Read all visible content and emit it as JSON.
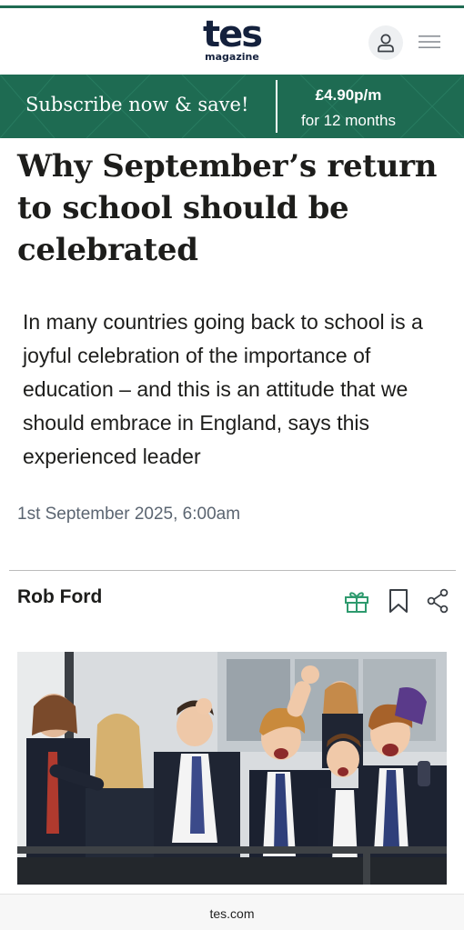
{
  "masthead": {
    "logo_word": "tes",
    "logo_sub": "magazine",
    "account_icon": "user-icon",
    "menu_icon": "hamburger-menu-icon"
  },
  "subscribe": {
    "cta": "Subscribe now & save!",
    "price": "£4.90p/m",
    "term": "for 12 months",
    "background_color": "#1e6b52"
  },
  "article": {
    "headline": "Why September’s return to school should be celebrated",
    "standfirst": "In many countries going back to school is a joyful celebration of the importance of education – and this is an attitude that we should embrace in England, says this experienced leader",
    "date": "1st September 2025, 6:00am",
    "author": "Rob Ford",
    "actions": {
      "gift_icon": "gift-icon",
      "bookmark_icon": "bookmark-icon",
      "share_icon": "share-icon"
    },
    "hero_image": "photo of cheering schoolchildren in uniform"
  },
  "footer": {
    "url": "tes.com"
  },
  "colors": {
    "brand_green": "#1e6b52",
    "navy": "#14213d",
    "date_grey": "#5b6571"
  }
}
